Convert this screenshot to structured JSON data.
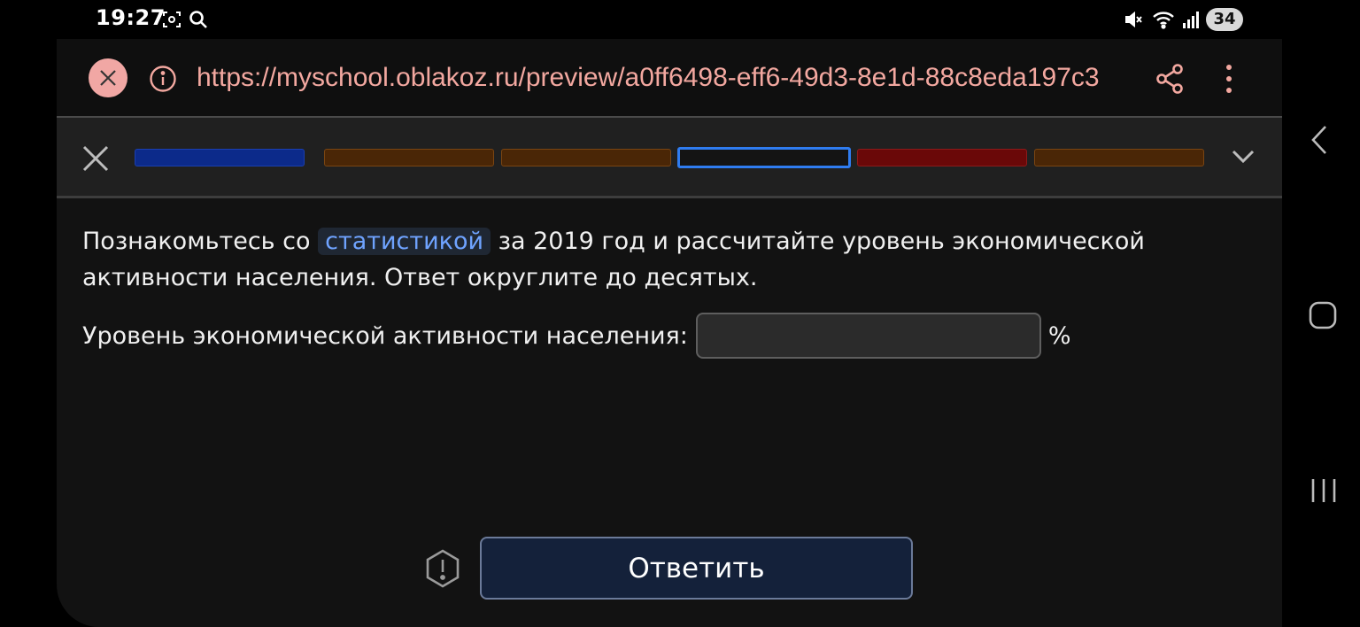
{
  "status_bar": {
    "time": "19:27",
    "battery": "34",
    "icons": [
      "screenshot-icon",
      "search-icon",
      "mute-icon",
      "wifi-icon",
      "signal-icon"
    ]
  },
  "browser": {
    "url": "https://myschool.oblakoz.ru/preview/a0ff6498-eff6-49d3-8e1d-88c8eda197c3"
  },
  "progress": {
    "segments": [
      {
        "state": "filled",
        "color": "#0c2a8a",
        "border": "#1a3fb0"
      },
      {
        "state": "filled",
        "color": "#4a2606",
        "border": "#7a4512"
      },
      {
        "state": "filled",
        "color": "#4a2606",
        "border": "#7a4512"
      },
      {
        "state": "current",
        "color": "#141414",
        "border": "#2f7cf0"
      },
      {
        "state": "filled",
        "color": "#6a0808",
        "border": "#8c1a1a"
      },
      {
        "state": "filled",
        "color": "#4a2606",
        "border": "#7a4512"
      }
    ]
  },
  "question": {
    "text_before": "Познакомьтесь со ",
    "link": "статистикой",
    "text_after": " за 2019 год и рассчитайте уровень экономической активности населения. Ответ округлите до десятых."
  },
  "answer": {
    "label": "Уровень экономической активности населения:",
    "value": "",
    "unit": "%"
  },
  "submit_label": "Ответить",
  "colors": {
    "accent_link": "#6fa3ff",
    "url": "#f3a8a0",
    "button_bg": "#14213a"
  }
}
